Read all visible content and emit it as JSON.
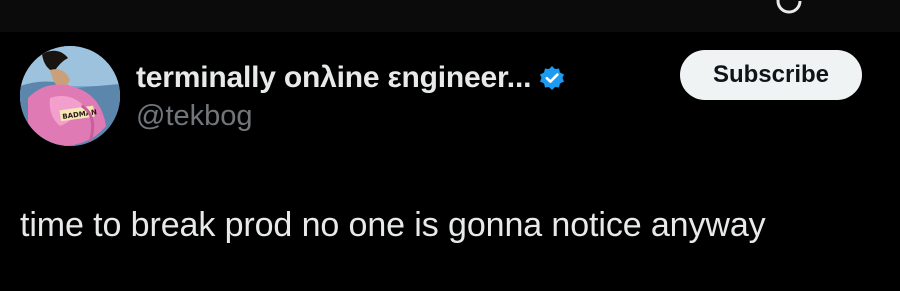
{
  "header": {
    "icons": [
      "refresh-icon"
    ]
  },
  "tweet": {
    "author": {
      "display_name": "terminally onλine εngineer...",
      "handle": "@tekbog",
      "avatar_text": "BADMAN",
      "verified": true
    },
    "subscribe_label": "Subscribe",
    "text": "time to break prod no one is gonna notice anyway"
  },
  "colors": {
    "background": "#000000",
    "primary_text": "#e7e9ea",
    "secondary_text": "#71767b",
    "verified_badge": "#1d9bf0",
    "button_bg": "#eff3f4",
    "button_text": "#0f1419"
  }
}
